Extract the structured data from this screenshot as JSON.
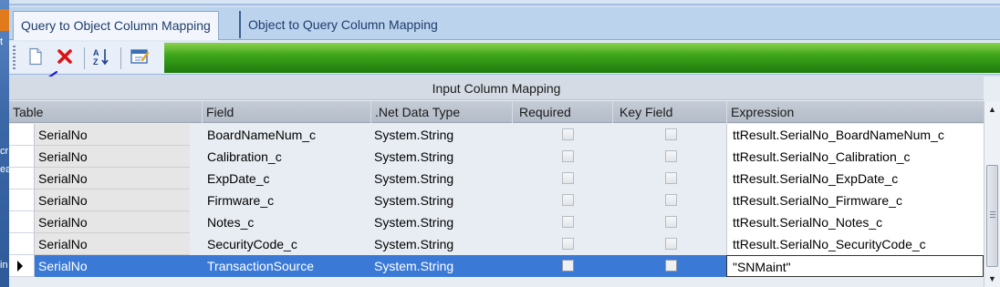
{
  "desktop": {
    "fragments": [
      "t",
      "cr",
      "ea",
      "in"
    ]
  },
  "tabs": [
    {
      "label": "Query to Object Column Mapping",
      "active": true
    },
    {
      "label": "Object to Query Column Mapping",
      "active": false
    }
  ],
  "toolbar": {
    "buttons": [
      {
        "icon": "new-document-icon"
      },
      {
        "icon": "delete-x-icon"
      },
      {
        "icon": "sort-az-icon"
      },
      {
        "icon": "edit-properties-icon"
      }
    ],
    "sort_glyph": "AZ"
  },
  "grid": {
    "caption": "Input Column Mapping",
    "columns": [
      "Table",
      "Field",
      ".Net Data Type",
      "Required",
      "Key Field",
      "Expression"
    ],
    "rows": [
      {
        "table": "SerialNo",
        "field": "BoardNameNum_c",
        "type": "System.String",
        "required": false,
        "key": false,
        "expression": "ttResult.SerialNo_BoardNameNum_c",
        "selected": false
      },
      {
        "table": "SerialNo",
        "field": "Calibration_c",
        "type": "System.String",
        "required": false,
        "key": false,
        "expression": "ttResult.SerialNo_Calibration_c",
        "selected": false
      },
      {
        "table": "SerialNo",
        "field": "ExpDate_c",
        "type": "System.String",
        "required": false,
        "key": false,
        "expression": "ttResult.SerialNo_ExpDate_c",
        "selected": false
      },
      {
        "table": "SerialNo",
        "field": "Firmware_c",
        "type": "System.String",
        "required": false,
        "key": false,
        "expression": "ttResult.SerialNo_Firmware_c",
        "selected": false
      },
      {
        "table": "SerialNo",
        "field": "Notes_c",
        "type": "System.String",
        "required": false,
        "key": false,
        "expression": "ttResult.SerialNo_Notes_c",
        "selected": false
      },
      {
        "table": "SerialNo",
        "field": "SecurityCode_c",
        "type": "System.String",
        "required": false,
        "key": false,
        "expression": "ttResult.SerialNo_SecurityCode_c",
        "selected": false
      },
      {
        "table": "SerialNo",
        "field": "TransactionSource",
        "type": "System.String",
        "required": false,
        "key": false,
        "expression": "\"SNMaint\"",
        "selected": true
      }
    ]
  },
  "colors": {
    "selection": "#3a7ad6",
    "toolbar_green": "#3fa61c",
    "annotation_arrow": "#1a1ad6"
  }
}
